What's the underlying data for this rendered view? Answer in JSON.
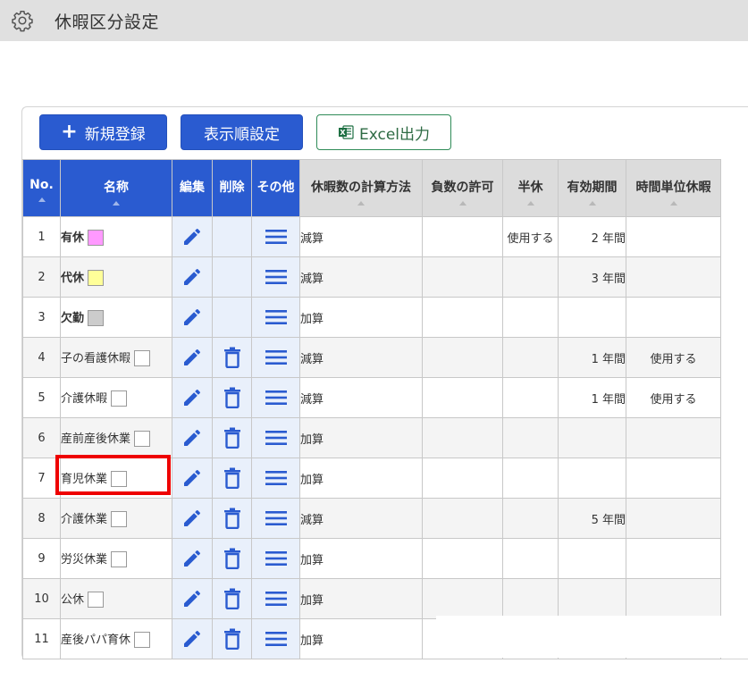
{
  "header": {
    "title": "休暇区分設定",
    "icon": "gear-icon"
  },
  "toolbar": {
    "new_label": "新規登録",
    "order_label": "表示順設定",
    "excel_label": "Excel出力"
  },
  "table": {
    "columns": {
      "no": "No.",
      "name": "名称",
      "edit": "編集",
      "delete": "削除",
      "other": "その他",
      "calc": "休暇数の計算方法",
      "negative": "負数の許可",
      "half": "半休",
      "validity": "有効期間",
      "hourly": "時間単位休暇"
    },
    "rows": [
      {
        "no": "1",
        "name": "有休",
        "swatch": "#ff99ff",
        "bold": true,
        "deletable": false,
        "calc": "減算",
        "negative": "",
        "half": "使用する",
        "validity": "2 年間",
        "hourly": ""
      },
      {
        "no": "2",
        "name": "代休",
        "swatch": "#ffff99",
        "bold": true,
        "deletable": false,
        "calc": "減算",
        "negative": "",
        "half": "",
        "validity": "3 年間",
        "hourly": ""
      },
      {
        "no": "3",
        "name": "欠勤",
        "swatch": "#cccccc",
        "bold": true,
        "deletable": false,
        "calc": "加算",
        "negative": "",
        "half": "",
        "validity": "",
        "hourly": ""
      },
      {
        "no": "4",
        "name": "子の看護休暇",
        "swatch": "#ffffff",
        "bold": false,
        "deletable": true,
        "calc": "減算",
        "negative": "",
        "half": "",
        "validity": "1 年間",
        "hourly": "使用する"
      },
      {
        "no": "5",
        "name": "介護休暇",
        "swatch": "#ffffff",
        "bold": false,
        "deletable": true,
        "calc": "減算",
        "negative": "",
        "half": "",
        "validity": "1 年間",
        "hourly": "使用する"
      },
      {
        "no": "6",
        "name": "産前産後休業",
        "swatch": "#ffffff",
        "bold": false,
        "deletable": true,
        "calc": "加算",
        "negative": "",
        "half": "",
        "validity": "",
        "hourly": ""
      },
      {
        "no": "7",
        "name": "育児休業",
        "swatch": "#ffffff",
        "bold": false,
        "deletable": true,
        "calc": "加算",
        "negative": "",
        "half": "",
        "validity": "",
        "hourly": ""
      },
      {
        "no": "8",
        "name": "介護休業",
        "swatch": "#ffffff",
        "bold": false,
        "deletable": true,
        "calc": "減算",
        "negative": "",
        "half": "",
        "validity": "5 年間",
        "hourly": ""
      },
      {
        "no": "9",
        "name": "労災休業",
        "swatch": "#ffffff",
        "bold": false,
        "deletable": true,
        "calc": "加算",
        "negative": "",
        "half": "",
        "validity": "",
        "hourly": ""
      },
      {
        "no": "10",
        "name": "公休",
        "swatch": "#ffffff",
        "bold": false,
        "deletable": true,
        "calc": "加算",
        "negative": "",
        "half": "",
        "validity": "",
        "hourly": ""
      },
      {
        "no": "11",
        "name": "産後パパ育休",
        "swatch": "#ffffff",
        "bold": false,
        "deletable": true,
        "calc": "加算",
        "negative": "",
        "half": "",
        "validity": "",
        "hourly": ""
      }
    ]
  },
  "colors": {
    "primary": "#2a5bd0",
    "highlight": "#ee0000",
    "excel": "#2e8b57"
  }
}
